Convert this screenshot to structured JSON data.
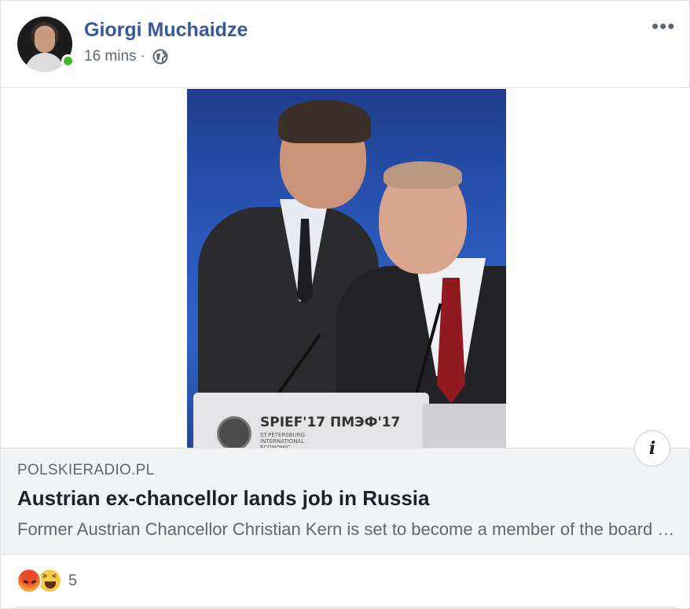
{
  "post": {
    "author": "Giorgi Muchaidze",
    "time": "16 mins",
    "separator": "·",
    "privacy_icon": "globe-icon",
    "online": true,
    "more_icon": "more-icon",
    "more_glyph": "•••"
  },
  "media": {
    "podium_text": "SPIEF'17  ПМЭФ'17",
    "podium_sub": "ST.PETERSBURG\nINTERNATIONAL\nECONOMIC",
    "info_glyph": "i"
  },
  "link": {
    "domain": "POLSKIERADIO.PL",
    "title": "Austrian ex-chancellor lands job in Russia",
    "description": "Former Austrian Chancellor Christian Kern is set to become a member of the board of directors of Russian State Railways, a spokesperson has said."
  },
  "reactions": {
    "types": [
      "angry-icon",
      "haha-icon"
    ],
    "count": "5"
  },
  "colors": {
    "author": "#385898",
    "online": "#42b72a",
    "meta": "#606770",
    "link_bg": "#f2f3f5"
  }
}
